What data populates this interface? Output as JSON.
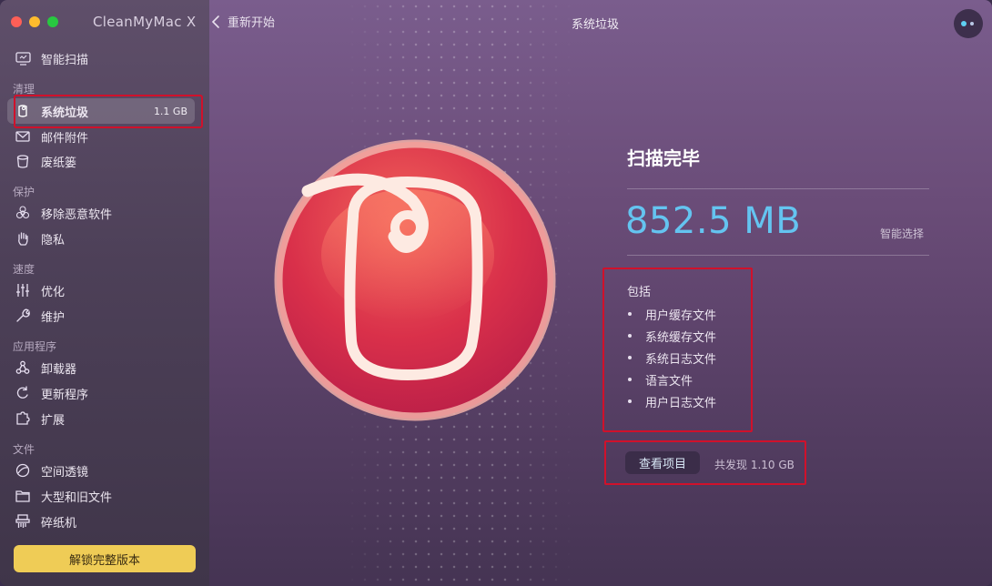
{
  "app": {
    "title": "CleanMyMac X"
  },
  "window_controls": [
    {
      "name": "close",
      "color": "#fe5f57"
    },
    {
      "name": "minimize",
      "color": "#febc2e"
    },
    {
      "name": "zoom",
      "color": "#28c840"
    }
  ],
  "sidebar": {
    "top_item": {
      "label": "智能扫描",
      "icon": "monitor-icon"
    },
    "sections": [
      {
        "label": "清理",
        "items": [
          {
            "label": "系统垃圾",
            "icon": "trash-bin-icon",
            "size": "1.1 GB",
            "active": true
          },
          {
            "label": "邮件附件",
            "icon": "mail-icon"
          },
          {
            "label": "废纸篓",
            "icon": "bin-icon"
          }
        ]
      },
      {
        "label": "保护",
        "items": [
          {
            "label": "移除恶意软件",
            "icon": "biohazard-icon"
          },
          {
            "label": "隐私",
            "icon": "hand-icon"
          }
        ]
      },
      {
        "label": "速度",
        "items": [
          {
            "label": "优化",
            "icon": "sliders-icon"
          },
          {
            "label": "维护",
            "icon": "wrench-icon"
          }
        ]
      },
      {
        "label": "应用程序",
        "items": [
          {
            "label": "卸载器",
            "icon": "uninstaller-icon"
          },
          {
            "label": "更新程序",
            "icon": "update-icon"
          },
          {
            "label": "扩展",
            "icon": "puzzle-icon"
          }
        ]
      },
      {
        "label": "文件",
        "items": [
          {
            "label": "空间透镜",
            "icon": "lens-icon"
          },
          {
            "label": "大型和旧文件",
            "icon": "folder-icon"
          },
          {
            "label": "碎纸机",
            "icon": "shredder-icon"
          }
        ]
      }
    ],
    "unlock_button": "解锁完整版本"
  },
  "topbar": {
    "back_label": "重新开始",
    "title": "系统垃圾"
  },
  "results": {
    "heading": "扫描完毕",
    "size": "852.5 MB",
    "smart_select": "智能选择",
    "includes_label": "包括",
    "includes": [
      "用户缓存文件",
      "系统缓存文件",
      "系统日志文件",
      "语言文件",
      "用户日志文件"
    ],
    "review_button": "查看项目",
    "found_text": "共发现 1.10 GB"
  },
  "colors": {
    "accent_blue": "#64c4f0",
    "unlock_yellow": "#efcc56",
    "highlight_red": "#d0112b"
  }
}
